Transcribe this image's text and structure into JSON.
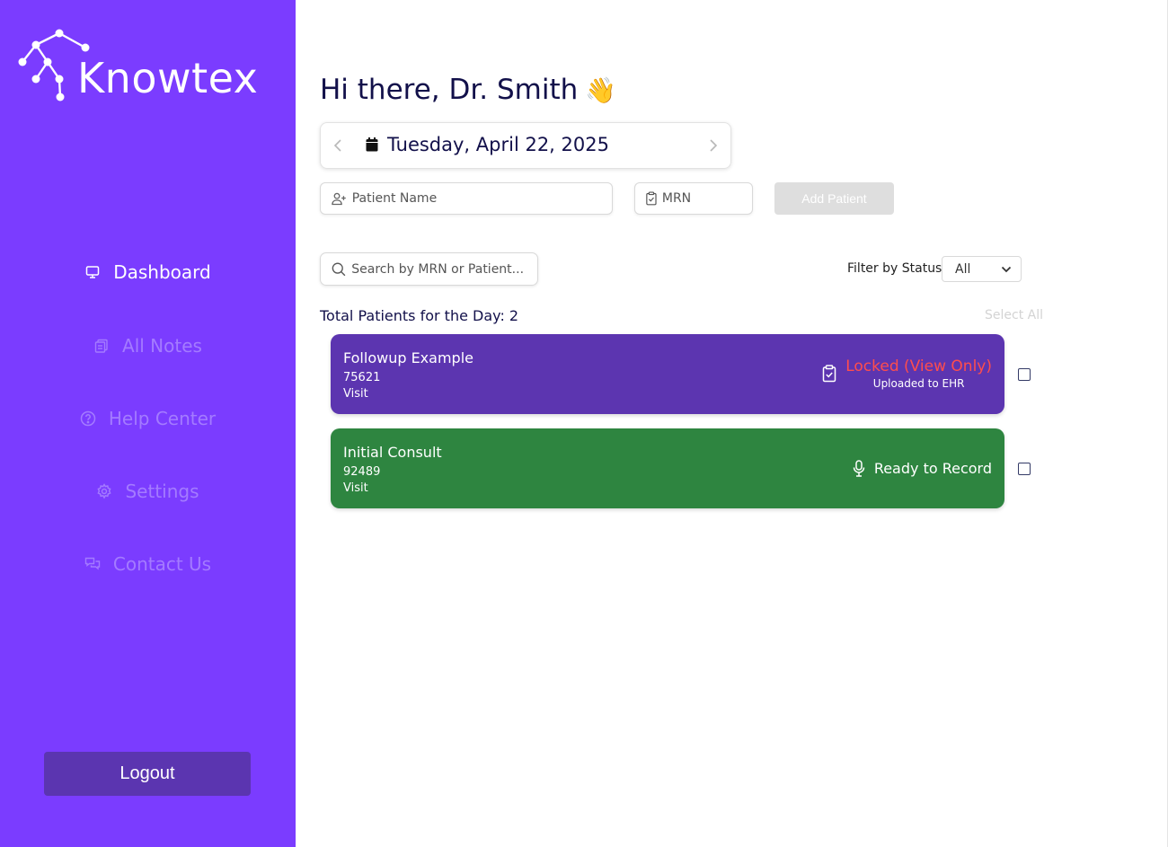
{
  "sidebar": {
    "brand": "Knowtex",
    "items": [
      {
        "label": "Dashboard",
        "icon": "monitor-icon",
        "active": true
      },
      {
        "label": "All Notes",
        "icon": "notes-icon",
        "active": false
      },
      {
        "label": "Help Center",
        "icon": "help-icon",
        "active": false
      },
      {
        "label": "Settings",
        "icon": "gear-icon",
        "active": false
      },
      {
        "label": "Contact Us",
        "icon": "chat-icon",
        "active": false
      }
    ],
    "logout_label": "Logout"
  },
  "header": {
    "greeting": "Hi there, Dr. Smith",
    "wave": "👋"
  },
  "date_nav": {
    "date": "Tuesday, April 22, 2025"
  },
  "add_form": {
    "patient_name_placeholder": "Patient Name",
    "mrn_placeholder": "MRN",
    "add_label": "Add Patient"
  },
  "search": {
    "placeholder": "Search by MRN or Patient..."
  },
  "filter": {
    "label": "Filter by Status",
    "selected": "All"
  },
  "summary": {
    "total_text": "Total Patients for the Day: 2",
    "select_all": "Select All"
  },
  "patients": [
    {
      "name": "Followup Example",
      "mrn": "75621",
      "type": "Visit",
      "status": "Locked (View Only)",
      "sub_status": "Uploaded to EHR"
    },
    {
      "name": "Initial Consult",
      "mrn": "92489",
      "type": "Visit",
      "status": "Ready to Record"
    }
  ],
  "colors": {
    "sidebar": "#7b3cff",
    "logout": "#5b35b0",
    "card_locked": "#5c35b0",
    "card_ready": "#2e8540",
    "locked_text": "#ff4d4d",
    "heading": "#12104a"
  }
}
